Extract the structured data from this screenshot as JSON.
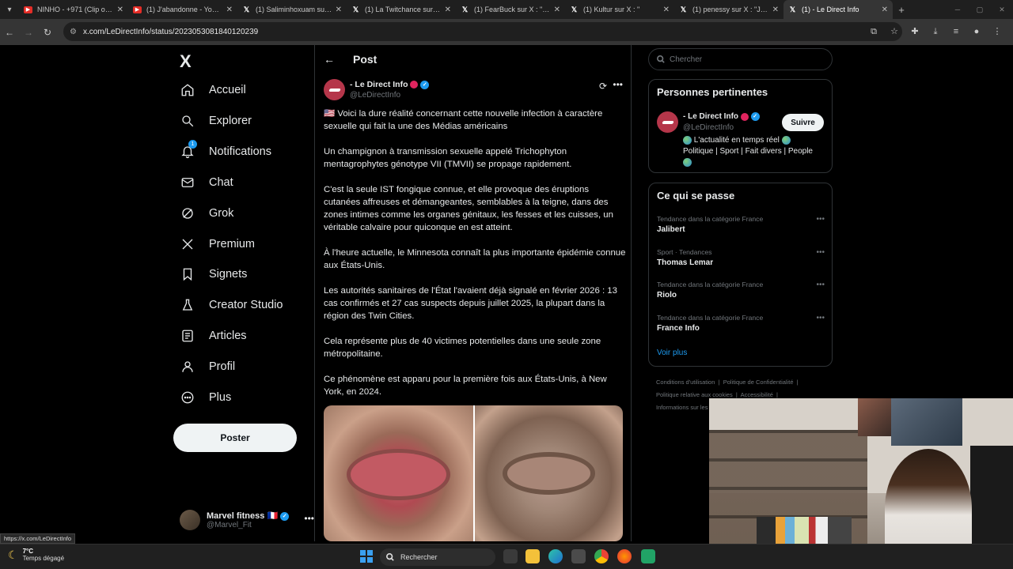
{
  "browser": {
    "tabs": [
      {
        "title": "NINHO - +971 (Clip offici",
        "icon": "youtube-icon"
      },
      {
        "title": "(1) J'abandonne - YouTub",
        "icon": "youtube-icon"
      },
      {
        "title": "(1) Saliminhoxuam sur X :",
        "icon": "x-icon"
      },
      {
        "title": "(1) La Twitchance sur X : ",
        "icon": "x-icon"
      },
      {
        "title": "(1) FearBuck sur X : \"Larry",
        "icon": "x-icon"
      },
      {
        "title": "(1) Kultur sur X : \"",
        "icon": "x-icon"
      },
      {
        "title": "(1) penessy sur X : \"Je sui",
        "icon": "x-icon"
      },
      {
        "title": "(1) - Le Direct Info",
        "icon": "x-icon",
        "active": true
      }
    ],
    "url": "x.com/LeDirectInfo/status/2023053081840120239",
    "status_url": "https://x.com/LeDirectInfo"
  },
  "nav": {
    "logo": "X",
    "items": [
      {
        "label": "Accueil",
        "icon": "home-icon"
      },
      {
        "label": "Explorer",
        "icon": "search-icon"
      },
      {
        "label": "Notifications",
        "icon": "bell-icon",
        "badge": "1"
      },
      {
        "label": "Chat",
        "icon": "mail-icon"
      },
      {
        "label": "Grok",
        "icon": "grok-icon"
      },
      {
        "label": "Premium",
        "icon": "x-logo-icon"
      },
      {
        "label": "Signets",
        "icon": "bookmark-icon"
      },
      {
        "label": "Creator Studio",
        "icon": "flask-icon"
      },
      {
        "label": "Articles",
        "icon": "article-icon"
      },
      {
        "label": "Profil",
        "icon": "person-icon"
      },
      {
        "label": "Plus",
        "icon": "more-circle-icon"
      }
    ],
    "post_label": "Poster",
    "account": {
      "name": "Marvel fitness",
      "flag": "🇫🇷",
      "handle": "@Marvel_Fit"
    }
  },
  "post": {
    "header_title": "Post",
    "author_name": "- Le Direct Info",
    "author_handle": "@LeDirectInfo",
    "paragraphs": [
      "🇺🇸 Voici la dure réalité concernant cette nouvelle infection à caractère sexuelle qui fait la une des Médias américains",
      "Un champignon à transmission sexuelle appelé Trichophyton mentagrophytes génotype VII (TMVII) se propage rapidement.",
      "C'est la seule IST fongique connue, et elle provoque des éruptions cutanées affreuses et démangeantes, semblables à la teigne, dans des zones intimes comme les organes génitaux, les fesses et les cuisses, un véritable calvaire pour quiconque en est atteint.",
      "À l'heure actuelle, le Minnesota connaît la plus importante épidémie connue aux États-Unis.",
      "Les autorités sanitaires de l'État l'avaient déjà signalé en février 2026 : 13 cas confirmés et 27 cas suspects depuis juillet 2025, la plupart dans la région des Twin Cities.",
      "Cela représente plus de 40 victimes potentielles dans une seule zone métropolitaine.",
      "Ce phénomène est apparu pour la première fois aux États-Unis, à New York, en 2024."
    ]
  },
  "sidebar": {
    "search_placeholder": "Chercher",
    "relevant": {
      "title": "Personnes pertinentes",
      "name": "- Le Direct Info",
      "handle": "@LeDirectInfo",
      "follow_label": "Suivre",
      "bio_line1": "L'actualité en temps réel",
      "bio_line2": "Politique | Sport | Fait divers | People"
    },
    "trends": {
      "title": "Ce qui se passe",
      "items": [
        {
          "category": "Tendance dans la catégorie France",
          "topic": "Jalibert"
        },
        {
          "category": "Sport · Tendances",
          "topic": "Thomas Lemar"
        },
        {
          "category": "Tendance dans la catégorie France",
          "topic": "Riolo"
        },
        {
          "category": "Tendance dans la catégorie France",
          "topic": "France Info"
        }
      ],
      "see_more": "Voir plus"
    },
    "footer": {
      "terms": "Conditions d'utilisation",
      "privacy": "Politique de Confidentialité",
      "cookies": "Politique relative aux cookies",
      "accessibility": "Accessibilité",
      "info": "Informations sur les"
    }
  },
  "taskbar": {
    "temperature": "7°C",
    "weather": "Temps dégagé",
    "search_label": "Rechercher"
  },
  "colors": {
    "accent": "#1d9bf0",
    "border": "#2f3336",
    "muted": "#71767b",
    "verified_red": "#e0245e"
  }
}
